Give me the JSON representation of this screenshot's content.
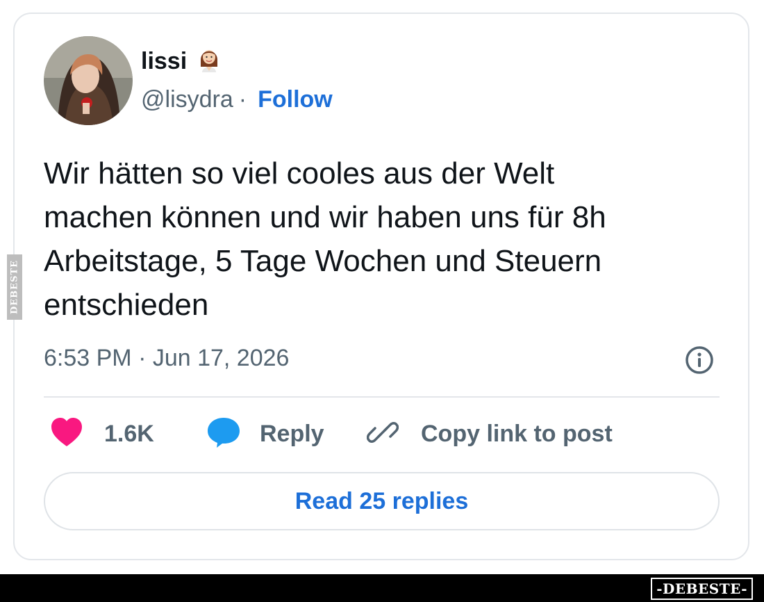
{
  "author": {
    "display_name": "lissi",
    "handle": "@lisydra",
    "separator": "·",
    "follow_label": "Follow"
  },
  "tweet": {
    "lines": [
      "Wir hätten so viel cooles aus der Welt",
      "machen können und wir haben uns für 8h",
      "Arbeitstage, 5 Tage Wochen und Steuern",
      "entschieden"
    ],
    "timestamp": "6:53 PM · Jun 17, 2026"
  },
  "actions": {
    "like_count": "1.6K",
    "reply_label": "Reply",
    "copy_link_label": "Copy link to post"
  },
  "read_replies_label": "Read 25 replies",
  "watermarks": {
    "side": "DEBESTE",
    "footer": "-DEBESTE-"
  },
  "colors": {
    "link_blue": "#1d6fd8",
    "heart_pink": "#f91880",
    "reply_blue": "#1d9bf0",
    "muted_text": "#536471"
  },
  "icons": [
    "woman-emoji-icon",
    "info-icon",
    "heart-icon",
    "reply-bubble-icon",
    "link-icon"
  ]
}
